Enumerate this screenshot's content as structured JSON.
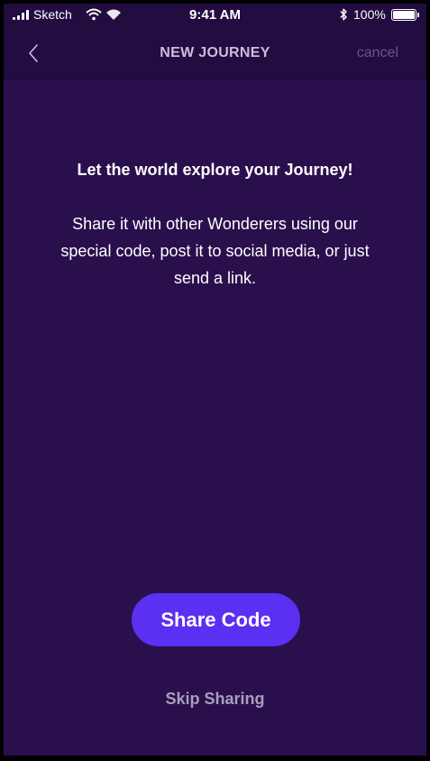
{
  "status_bar": {
    "carrier": "Sketch",
    "time": "9:41 AM",
    "battery_percent": "100%",
    "battery_level": 1.0,
    "icons": [
      "signal-icon",
      "wifi-icon",
      "bluetooth-icon",
      "battery-icon"
    ]
  },
  "nav": {
    "back_icon": "chevron-left-icon",
    "title": "NEW JOURNEY",
    "cancel_label": "cancel"
  },
  "main": {
    "heading": "Let the world explore your Journey!",
    "description": "Share it with other Wonderers using our special code, post it to social media, or just send a link.",
    "share_button_label": "Share Code",
    "skip_label": "Skip Sharing"
  },
  "colors": {
    "background": "#2a0f4d",
    "top_bar": "#220c40",
    "accent": "#5a30f2",
    "muted_text": "#a79fbd",
    "cancel_text": "#6a5887"
  }
}
